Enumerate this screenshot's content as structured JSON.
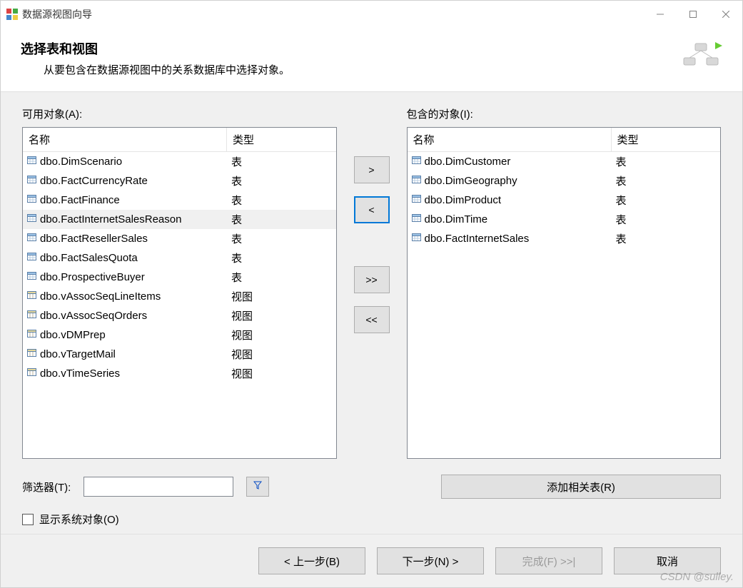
{
  "window": {
    "title": "数据源视图向导"
  },
  "header": {
    "title": "选择表和视图",
    "subtitle": "从要包含在数据源视图中的关系数据库中选择对象。"
  },
  "available": {
    "label": "可用对象(A):",
    "columns": {
      "name": "名称",
      "type": "类型"
    },
    "items": [
      {
        "name": "dbo.DimScenario",
        "type": "表",
        "icon": "table"
      },
      {
        "name": "dbo.FactCurrencyRate",
        "type": "表",
        "icon": "table"
      },
      {
        "name": "dbo.FactFinance",
        "type": "表",
        "icon": "table"
      },
      {
        "name": "dbo.FactInternetSalesReason",
        "type": "表",
        "icon": "table",
        "selected": true
      },
      {
        "name": "dbo.FactResellerSales",
        "type": "表",
        "icon": "table"
      },
      {
        "name": "dbo.FactSalesQuota",
        "type": "表",
        "icon": "table"
      },
      {
        "name": "dbo.ProspectiveBuyer",
        "type": "表",
        "icon": "table"
      },
      {
        "name": "dbo.vAssocSeqLineItems",
        "type": "视图",
        "icon": "view"
      },
      {
        "name": "dbo.vAssocSeqOrders",
        "type": "视图",
        "icon": "view"
      },
      {
        "name": "dbo.vDMPrep",
        "type": "视图",
        "icon": "view"
      },
      {
        "name": "dbo.vTargetMail",
        "type": "视图",
        "icon": "view"
      },
      {
        "name": "dbo.vTimeSeries",
        "type": "视图",
        "icon": "view"
      }
    ]
  },
  "included": {
    "label": "包含的对象(I):",
    "columns": {
      "name": "名称",
      "type": "类型"
    },
    "items": [
      {
        "name": "dbo.DimCustomer",
        "type": "表",
        "icon": "table"
      },
      {
        "name": "dbo.DimGeography",
        "type": "表",
        "icon": "table"
      },
      {
        "name": "dbo.DimProduct",
        "type": "表",
        "icon": "table"
      },
      {
        "name": "dbo.DimTime",
        "type": "表",
        "icon": "table"
      },
      {
        "name": "dbo.FactInternetSales",
        "type": "表",
        "icon": "table"
      }
    ]
  },
  "transfer": {
    "add": ">",
    "remove": "<",
    "addAll": ">>",
    "removeAll": "<<"
  },
  "filter": {
    "label": "筛选器(T):",
    "value": "",
    "placeholder": ""
  },
  "addRelated": "添加相关表(R)",
  "showSystem": "显示系统对象(O)",
  "footer": {
    "back": "< 上一步(B)",
    "next": "下一步(N) >",
    "finish": "完成(F) >>|",
    "cancel": "取消"
  },
  "watermark": "CSDN @sulley."
}
